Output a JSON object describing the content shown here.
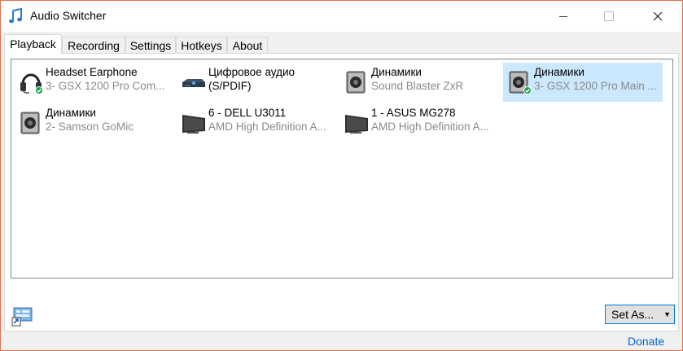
{
  "window": {
    "title": "Audio Switcher"
  },
  "tabs": [
    {
      "label": "Playback"
    },
    {
      "label": "Recording"
    },
    {
      "label": "Settings"
    },
    {
      "label": "Hotkeys"
    },
    {
      "label": "About"
    }
  ],
  "devices": [
    {
      "name": "Headset Earphone",
      "sub": "3- GSX 1200 Pro Com...",
      "icon": "headset-icon",
      "default": true
    },
    {
      "name": "Цифровое аудио",
      "sub": "(S/PDIF)",
      "icon": "spdif-icon",
      "default": false
    },
    {
      "name": "Динамики",
      "sub": "Sound Blaster ZxR",
      "icon": "speaker-icon",
      "default": false
    },
    {
      "name": "Динамики",
      "sub": "3- GSX 1200 Pro Main ...",
      "icon": "speaker-icon",
      "default": true,
      "selected": true
    },
    {
      "name": "Динамики",
      "sub": "2- Samson GoMic",
      "icon": "speaker-icon",
      "default": false
    },
    {
      "name": "6 - DELL U3011",
      "sub": "AMD High Definition A...",
      "icon": "monitor-icon",
      "default": false
    },
    {
      "name": "1 - ASUS MG278",
      "sub": "AMD High Definition A...",
      "icon": "monitor-icon",
      "default": false
    }
  ],
  "footer": {
    "set_as_label": "Set As...",
    "donate_label": "Donate"
  },
  "colors": {
    "selection": "#cce8ff",
    "link": "#0066cc",
    "accent": "#0078d7"
  }
}
